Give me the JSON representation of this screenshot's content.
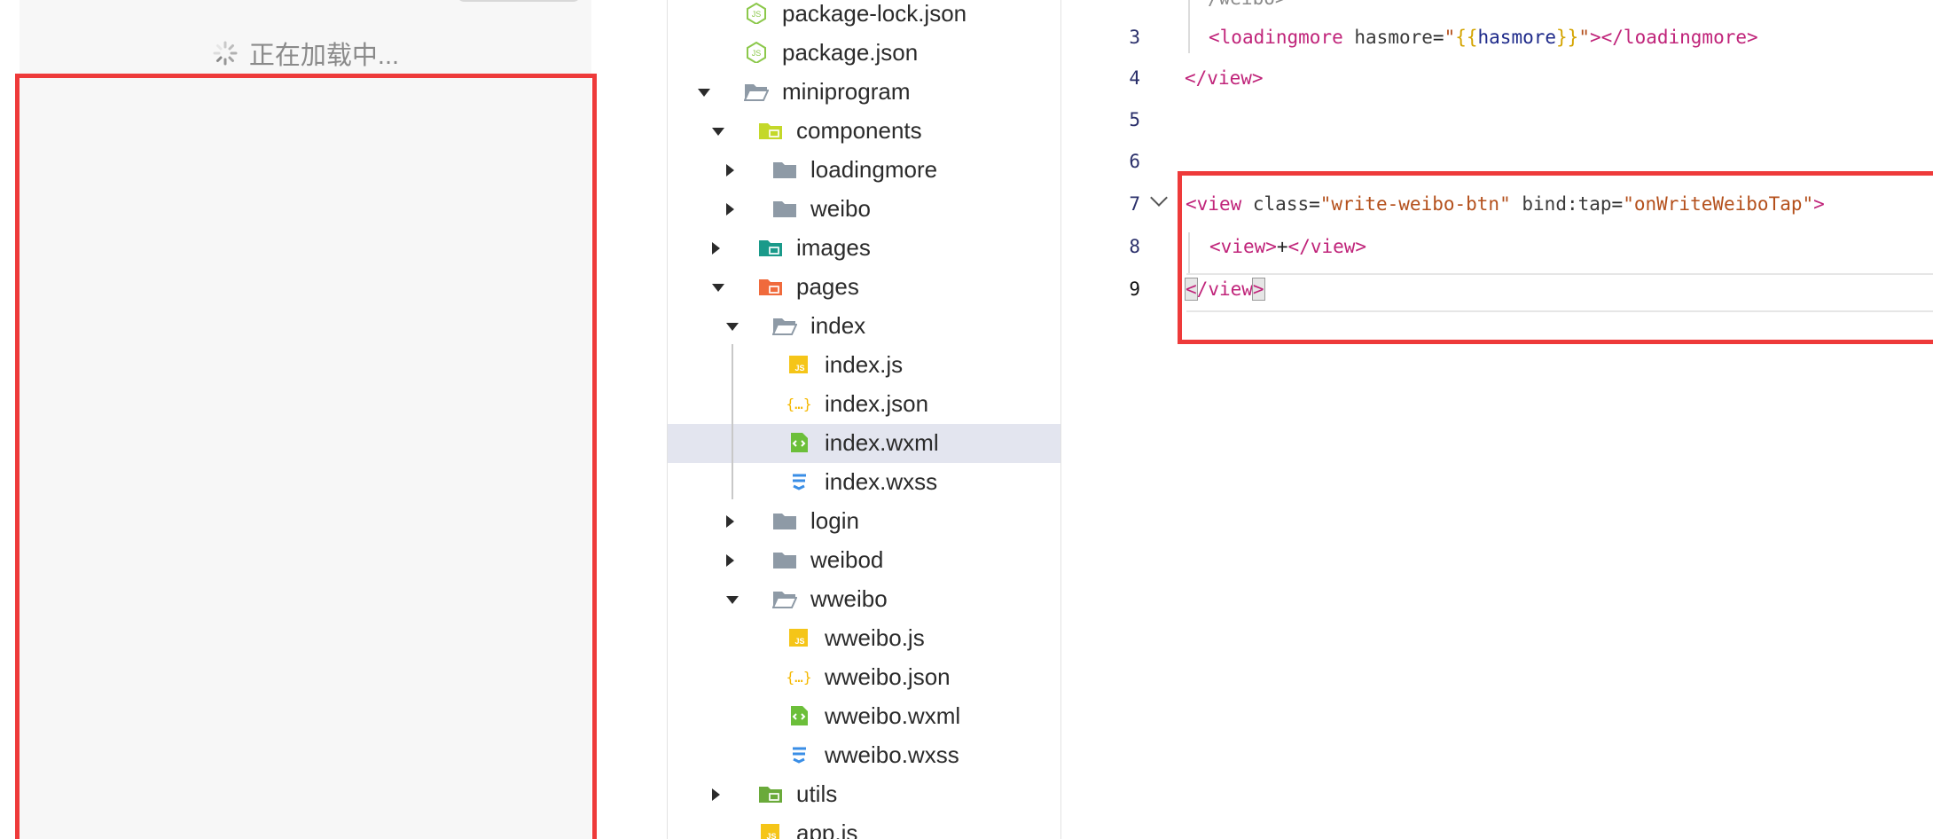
{
  "simulator": {
    "loading_text": "正在加载中..."
  },
  "file_tree": {
    "items": [
      {
        "label": "package-lock.json",
        "icon": "nodejs-file-icon",
        "kind": "file"
      },
      {
        "label": "package.json",
        "icon": "nodejs-file-icon",
        "kind": "file"
      },
      {
        "label": "miniprogram",
        "icon": "folder-open-icon",
        "kind": "folder",
        "expanded": true
      },
      {
        "label": "components",
        "icon": "components-folder-icon",
        "kind": "folder",
        "expanded": true
      },
      {
        "label": "loadingmore",
        "icon": "folder-icon",
        "kind": "folder",
        "expanded": false
      },
      {
        "label": "weibo",
        "icon": "folder-icon",
        "kind": "folder",
        "expanded": false
      },
      {
        "label": "images",
        "icon": "images-folder-icon",
        "kind": "folder",
        "expanded": false
      },
      {
        "label": "pages",
        "icon": "pages-folder-icon",
        "kind": "folder",
        "expanded": true
      },
      {
        "label": "index",
        "icon": "folder-open-icon",
        "kind": "folder",
        "expanded": true
      },
      {
        "label": "index.js",
        "icon": "js-file-icon",
        "kind": "file"
      },
      {
        "label": "index.json",
        "icon": "json-file-icon",
        "kind": "file"
      },
      {
        "label": "index.wxml",
        "icon": "wxml-file-icon",
        "kind": "file",
        "selected": true
      },
      {
        "label": "index.wxss",
        "icon": "wxss-file-icon",
        "kind": "file"
      },
      {
        "label": "login",
        "icon": "folder-icon",
        "kind": "folder",
        "expanded": false
      },
      {
        "label": "weibod",
        "icon": "folder-icon",
        "kind": "folder",
        "expanded": false
      },
      {
        "label": "wweibo",
        "icon": "folder-open-icon",
        "kind": "folder",
        "expanded": true
      },
      {
        "label": "wweibo.js",
        "icon": "js-file-icon",
        "kind": "file"
      },
      {
        "label": "wweibo.json",
        "icon": "json-file-icon",
        "kind": "file"
      },
      {
        "label": "wweibo.wxml",
        "icon": "wxml-file-icon",
        "kind": "file"
      },
      {
        "label": "wweibo.wxss",
        "icon": "wxss-file-icon",
        "kind": "file"
      },
      {
        "label": "utils",
        "icon": "utils-folder-icon",
        "kind": "folder",
        "expanded": false
      },
      {
        "label": "app.js",
        "icon": "js-file-icon",
        "kind": "file"
      }
    ]
  },
  "editor": {
    "partial_line": "/weibo>",
    "lines": [
      {
        "number": "3"
      },
      {
        "number": "4"
      },
      {
        "number": "5"
      },
      {
        "number": "6"
      },
      {
        "number": "7"
      },
      {
        "number": "8"
      },
      {
        "number": "9"
      }
    ],
    "tokens": {
      "loadingmore_tag": "loadingmore",
      "hasmore_attr": "hasmore",
      "hasmore_var": "hasmore",
      "view_tag": "view",
      "class_attr": "class",
      "class_value": "write-weibo-btn",
      "bindtap_attr": "bind:tap",
      "bindtap_value": "onWriteWeiboTap",
      "plus_text": "+"
    }
  },
  "colors": {
    "highlight_box": "#ee3a3a",
    "selected_row": "#e3e5ef",
    "tag": "#c0247a",
    "string": "#b4501c",
    "mustache": "#d4a400"
  }
}
